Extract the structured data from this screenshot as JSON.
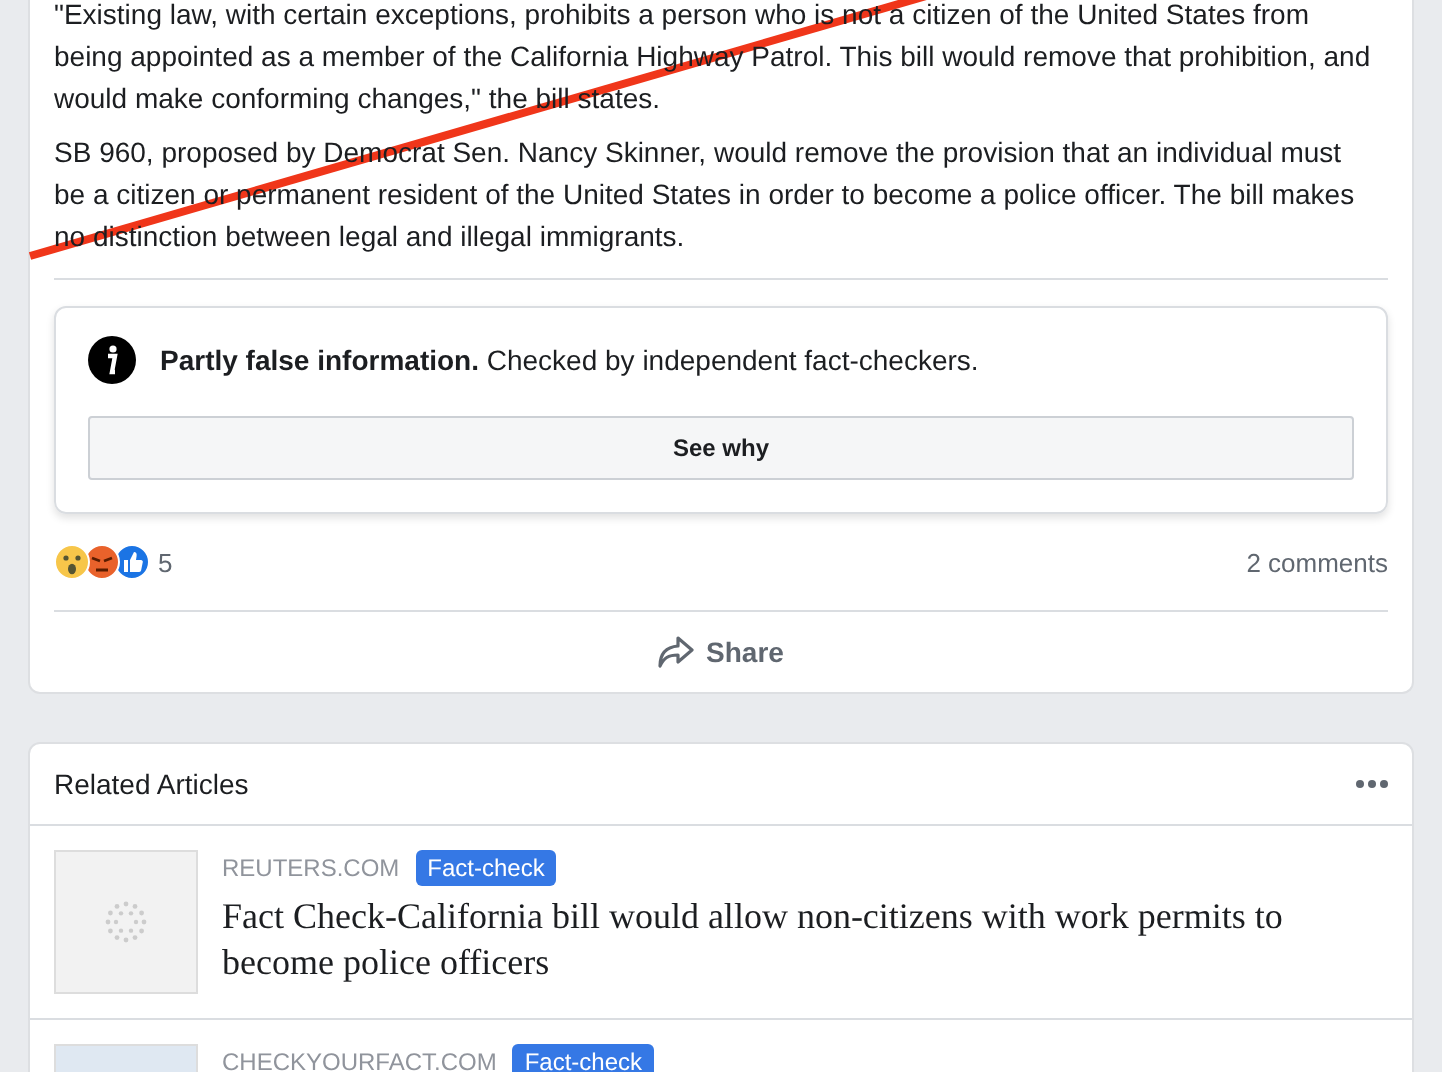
{
  "post": {
    "paragraphs": [
      "\"Existing law, with certain exceptions, prohibits a person who is not a citizen of the United States from being appointed as a member of the California Highway Patrol. This bill would remove that prohibition, and would make conforming changes,\" the bill states.",
      "SB 960, proposed by Democrat Sen. Nancy Skinner, would remove the provision that an individual must be a citizen or permanent resident of the United States in order to become a police officer. The bill makes no distinction between legal and illegal immigrants."
    ],
    "fact_check": {
      "text": "**Partly false information.** Checked by independent fact-checkers.",
      "button": "See why"
    },
    "reaction_count": "5",
    "comments": "2 comments",
    "share": "Share"
  },
  "related": {
    "title": "Related Articles",
    "articles": [
      {
        "source": "REUTERS.COM",
        "tag": "Fact-check",
        "title": "Fact Check-California bill would allow non-citizens with work permits to become police officers"
      },
      {
        "source": "CHECKYOURFACT.COM",
        "tag": "Fact-check"
      }
    ]
  }
}
